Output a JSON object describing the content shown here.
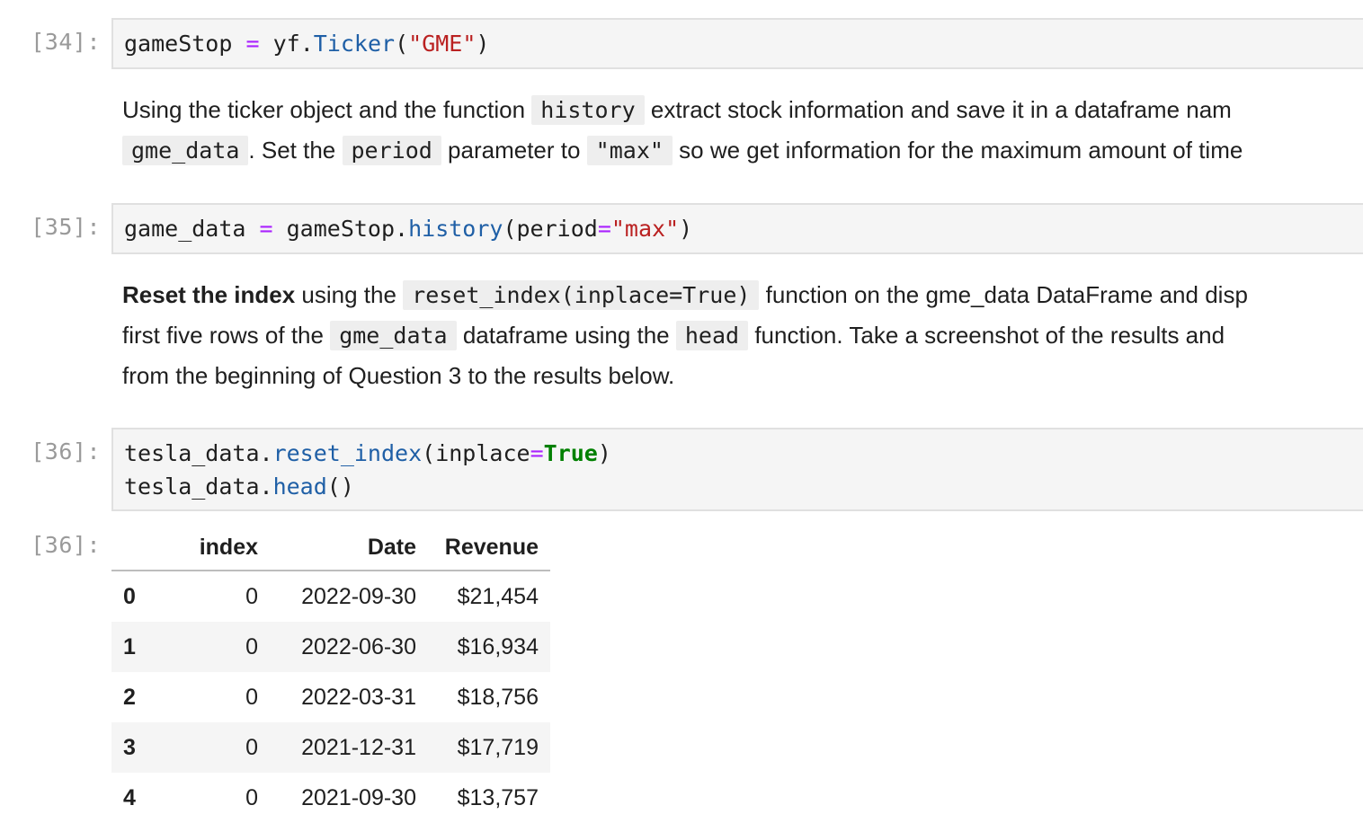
{
  "cells": {
    "c34": {
      "prompt": "[34]:",
      "t1": "gameStop",
      "t2": " ",
      "t3": "=",
      "t4": " yf.",
      "t5": "Ticker",
      "t6": "(",
      "t7": "\"GME\"",
      "t8": ")"
    },
    "md1": {
      "l1a": "Using the ticker object and the function ",
      "l1b": "history",
      "l1c": " extract stock information and save it in a dataframe nam",
      "l2a": "gme_data",
      "l2b": ". Set the ",
      "l2c": "period",
      "l2d": " parameter to ",
      "l2e": "\"max\"",
      "l2f": " so we get information for the maximum amount of time"
    },
    "c35": {
      "prompt": "[35]:",
      "t1": "game_data ",
      "t2": "=",
      "t3": " gameStop.",
      "t4": "history",
      "t5": "(period",
      "t6": "=",
      "t7": "\"max\"",
      "t8": ")"
    },
    "md2": {
      "l1a": "Reset the index",
      "l1b": " using the ",
      "l1c": "reset_index(inplace=True)",
      "l1d": " function on the gme_data DataFrame and disp",
      "l2a": "first five rows of the ",
      "l2b": "gme_data",
      "l2c": " dataframe using the ",
      "l2d": "head",
      "l2e": " function. Take a screenshot of the results and",
      "l3": "from the beginning of Question 3 to the results below."
    },
    "c36": {
      "prompt": "[36]:",
      "l1a": "tesla_data.",
      "l1b": "reset_index",
      "l1c": "(inplace",
      "l1d": "=",
      "l1e": "True",
      "l1f": ")",
      "l2a": "tesla_data.",
      "l2b": "head",
      "l2c": "()"
    },
    "out36": {
      "prompt": "[36]:",
      "columns": [
        "",
        "index",
        "Date",
        "Revenue"
      ],
      "rows": [
        [
          "0",
          "0",
          "2022-09-30",
          "$21,454"
        ],
        [
          "1",
          "0",
          "2022-06-30",
          "$16,934"
        ],
        [
          "2",
          "0",
          "2022-03-31",
          "$18,756"
        ],
        [
          "3",
          "0",
          "2021-12-31",
          "$17,719"
        ],
        [
          "4",
          "0",
          "2021-09-30",
          "$13,757"
        ]
      ]
    }
  }
}
